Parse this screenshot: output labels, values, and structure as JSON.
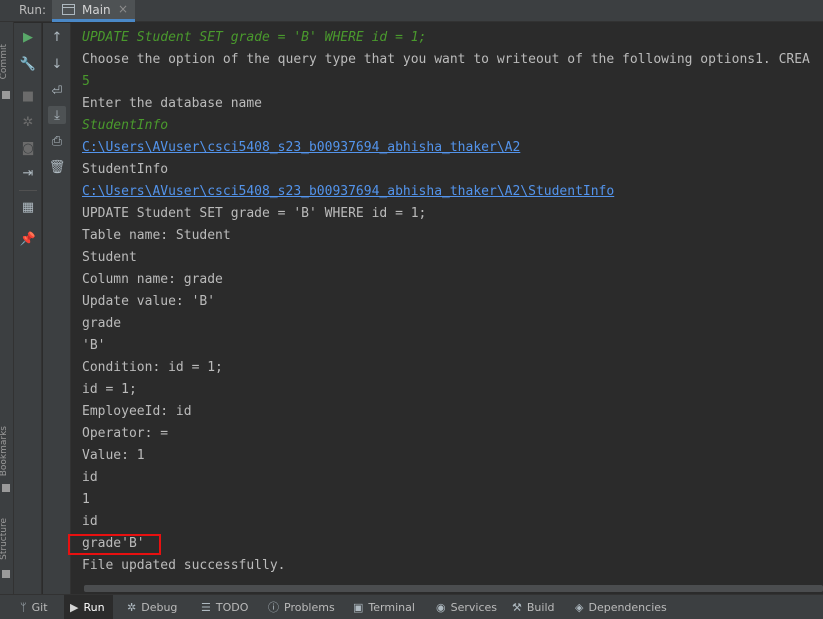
{
  "runbar": {
    "label": "Run:",
    "tab_label": "Main",
    "close": "×"
  },
  "side_labels": {
    "top": "P",
    "commit": "Commit",
    "bookmarks": "Bookmarks",
    "structure": "Structure"
  },
  "toolbar_icons": [
    "run-icon",
    "up-arrow-icon",
    "wrench-icon",
    "down-arrow-icon",
    "stop-icon",
    "soft-wrap-icon",
    "debug-icon",
    "scroll-to-end-icon",
    "camera-icon",
    "print-icon",
    "exit-icon",
    "trash-icon",
    "layout-icon",
    "pin-icon"
  ],
  "console": {
    "lines": [
      {
        "text": "UPDATE Student SET grade = 'B' WHERE id = 1;",
        "kind": "input"
      },
      {
        "text": "Choose the option of the query type that you want to writeout of the following options1. CREA",
        "kind": "normal"
      },
      {
        "text": "5",
        "kind": "num"
      },
      {
        "text": "Enter the database name",
        "kind": "normal"
      },
      {
        "text": "StudentInfo",
        "kind": "input"
      },
      {
        "text": "C:\\Users\\AVuser\\csci5408_s23_b00937694_abhisha_thaker\\A2",
        "kind": "link"
      },
      {
        "text": "StudentInfo",
        "kind": "normal"
      },
      {
        "text": "C:\\Users\\AVuser\\csci5408_s23_b00937694_abhisha_thaker\\A2\\StudentInfo",
        "kind": "link"
      },
      {
        "text": "UPDATE Student SET grade = 'B' WHERE id = 1;",
        "kind": "normal"
      },
      {
        "text": "Table name: Student",
        "kind": "normal"
      },
      {
        "text": "Student",
        "kind": "normal"
      },
      {
        "text": "Column name: grade",
        "kind": "normal"
      },
      {
        "text": "Update value: 'B'",
        "kind": "normal"
      },
      {
        "text": "grade",
        "kind": "normal"
      },
      {
        "text": "'B'",
        "kind": "normal"
      },
      {
        "text": "Condition: id = 1;",
        "kind": "normal"
      },
      {
        "text": "id = 1;",
        "kind": "normal"
      },
      {
        "text": "EmployeeId: id",
        "kind": "normal"
      },
      {
        "text": "Operator: =",
        "kind": "normal"
      },
      {
        "text": "Value: 1",
        "kind": "normal"
      },
      {
        "text": "id",
        "kind": "normal"
      },
      {
        "text": "1",
        "kind": "normal"
      },
      {
        "text": "id",
        "kind": "normal"
      },
      {
        "text": "grade'B'",
        "kind": "normal"
      },
      {
        "text": "File updated successfully.",
        "kind": "normal"
      }
    ]
  },
  "bottombar": {
    "tabs": [
      {
        "label": "Git",
        "icon": "git-icon"
      },
      {
        "label": "Run",
        "icon": "run-icon",
        "active": true
      },
      {
        "label": "Debug",
        "icon": "debug-icon"
      },
      {
        "label": "TODO",
        "icon": "todo-icon"
      },
      {
        "label": "Problems",
        "icon": "problems-icon"
      },
      {
        "label": "Terminal",
        "icon": "terminal-icon"
      },
      {
        "label": "Services",
        "icon": "services-icon"
      },
      {
        "label": "Build",
        "icon": "build-icon"
      },
      {
        "label": "Dependencies",
        "icon": "dependencies-icon"
      }
    ]
  },
  "colors": {
    "background": "#2b2b2b",
    "panel": "#3c3f41",
    "input_text": "#4a9a2d",
    "link": "#5394ec",
    "highlight": "#e81010",
    "tab_underline": "#4a88c7"
  }
}
